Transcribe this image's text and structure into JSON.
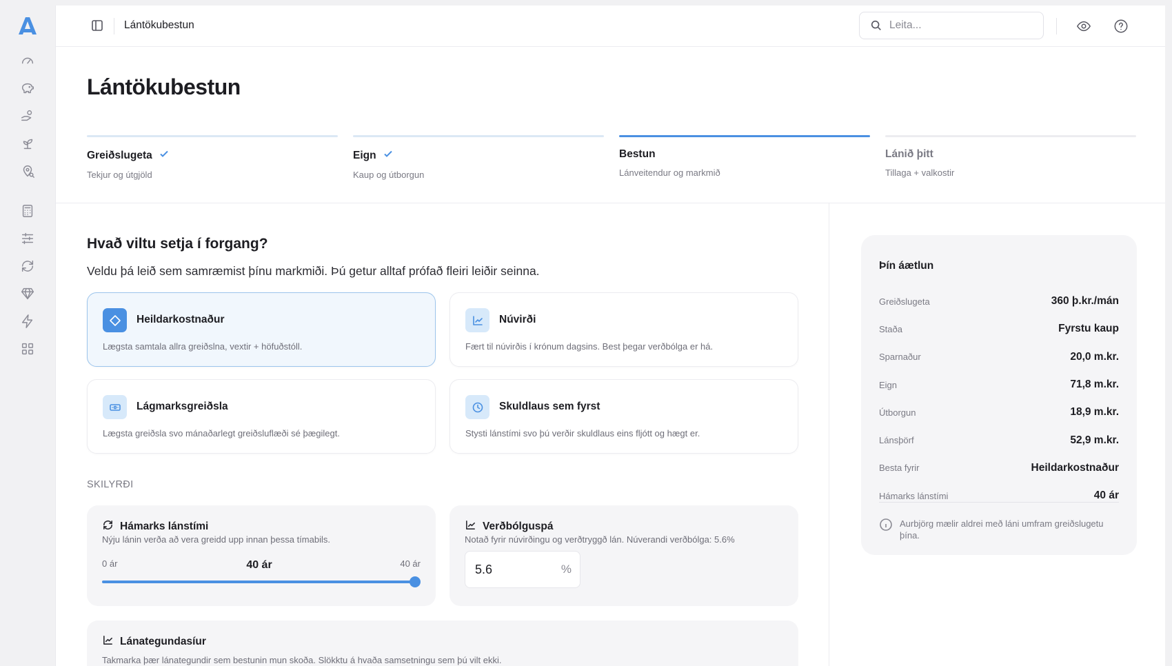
{
  "colors": {
    "accent": "#4a90e2",
    "accent_light": "#d7e9fa",
    "panel_bg": "#f5f5f7"
  },
  "sidebar": {
    "logo_icon": "letter-a-logo",
    "group1": [
      "gauge-icon",
      "piggy-bank-icon",
      "hand-coins-icon",
      "sprout-icon",
      "map-pin-search-icon"
    ],
    "group2": [
      "calculator-icon",
      "sliders-icon",
      "refresh-icon",
      "gem-icon",
      "lightning-icon",
      "grid-icon"
    ]
  },
  "header": {
    "breadcrumb": "Lántökubestun",
    "search_placeholder": "Leita..."
  },
  "page": {
    "title": "Lántökubestun"
  },
  "steps": [
    {
      "title": "Greiðslugeta",
      "subtitle": "Tekjur og útgjöld",
      "state": "done"
    },
    {
      "title": "Eign",
      "subtitle": "Kaup og útborgun",
      "state": "done"
    },
    {
      "title": "Bestun",
      "subtitle": "Lánveitendur og markmið",
      "state": "active"
    },
    {
      "title": "Lánið þitt",
      "subtitle": "Tillaga + valkostir",
      "state": "future"
    }
  ],
  "priority": {
    "title": "Hvað viltu setja í forgang?",
    "subtitle": "Veldu þá leið sem samræmist þínu markmiði. Þú getur alltaf prófað fleiri leiðir seinna.",
    "options": [
      {
        "title": "Heildarkostnaður",
        "desc": "Lægsta samtala allra greiðslna, vextir + höfuðstóll.",
        "icon": "diamond-icon",
        "selected": true
      },
      {
        "title": "Núvirði",
        "desc": "Fært til núvirðis í krónum dagsins. Best þegar verðbólga er há.",
        "icon": "line-chart-icon",
        "selected": false
      },
      {
        "title": "Lágmarksgreiðsla",
        "desc": "Lægsta greiðsla svo mánaðarlegt greiðsluflæði sé þægilegt.",
        "icon": "banknote-icon",
        "selected": false
      },
      {
        "title": "Skuldlaus sem fyrst",
        "desc": "Stysti lánstími svo þú verðir skuldlaus eins fljótt og hægt er.",
        "icon": "clock-icon",
        "selected": false
      }
    ]
  },
  "conditions": {
    "label": "SKILYRÐI",
    "max_term": {
      "title": "Hámarks lánstími",
      "desc": "Nýju lánin verða að vera greidd upp innan þessa tímabils.",
      "min_label": "0 ár",
      "max_label": "40 ár",
      "value_label": "40 ár",
      "fraction": 1.0
    },
    "inflation": {
      "title": "Verðbólguspá",
      "desc": "Notað fyrir núvirðingu og verðtryggð lán. Núverandi verðbólga: 5.6%",
      "value": "5.6",
      "unit": "%"
    },
    "loan_filters": {
      "title": "Lánategundasíur",
      "desc": "Takmarka þær lánategundir sem bestunin mun skoða. Slökktu á hvaða samsetningu sem þú vilt ekki."
    }
  },
  "summary": {
    "title": "Þín áætlun",
    "rows": [
      {
        "k": "Greiðslugeta",
        "v": "360 þ.kr./mán"
      },
      {
        "k": "Staða",
        "v": "Fyrstu kaup"
      },
      {
        "k": "Sparnaður",
        "v": "20,0 m.kr."
      },
      {
        "k": "Eign",
        "v": "71,8 m.kr."
      },
      {
        "k": "Útborgun",
        "v": "18,9 m.kr."
      },
      {
        "k": "Lánsþörf",
        "v": "52,9 m.kr."
      },
      {
        "k": "Besta fyrir",
        "v": "Heildarkostnaður"
      },
      {
        "k": "Hámarks lánstími",
        "v": "40 ár"
      }
    ],
    "note": "Aurbjörg mælir aldrei með láni umfram greiðslugetu þína."
  }
}
